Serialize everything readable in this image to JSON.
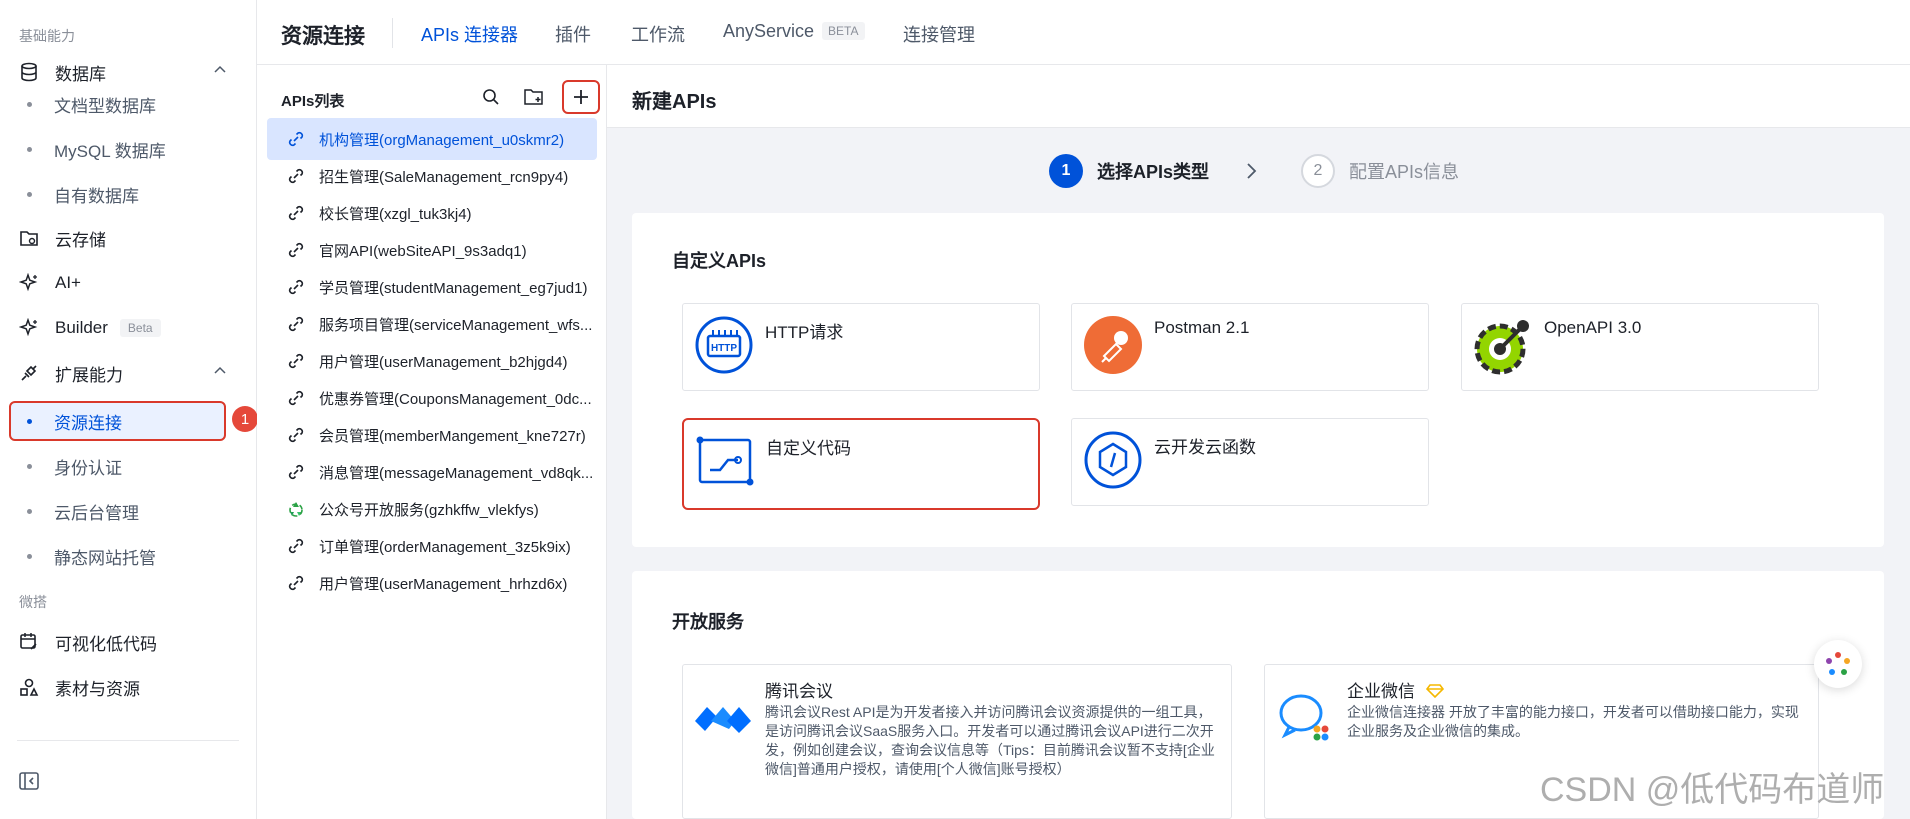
{
  "sidebar": {
    "section_basic": "基础能力",
    "database": "数据库",
    "db_items": [
      "文档型数据库",
      "MySQL 数据库",
      "自有数据库"
    ],
    "cloud_storage": "云存储",
    "ai": "AI+",
    "builder": "Builder",
    "builder_tag": "Beta",
    "extension": "扩展能力",
    "ext_items": [
      "资源连接",
      "身份认证",
      "云后台管理",
      "静态网站托管"
    ],
    "active_item": "资源连接",
    "step_badge": "1",
    "section_micro": "微搭",
    "lowcode": "可视化低代码",
    "assets": "素材与资源"
  },
  "topbar": {
    "title": "资源连接",
    "tabs": [
      "APIs 连接器",
      "插件",
      "工作流",
      "AnyService",
      "连接管理"
    ],
    "anyservice_tag": "BETA",
    "active_tab": "APIs 连接器"
  },
  "api_list": {
    "title": "APIs列表",
    "items": [
      "机构管理(orgManagement_u0skmr2)",
      "招生管理(SaleManagement_rcn9py4)",
      "校长管理(xzgl_tuk3kj4)",
      "官网API(webSiteAPI_9s3adq1)",
      "学员管理(studentManagement_eg7jud1)",
      "服务项目管理(serviceManagement_wfs...",
      "用户管理(userManagement_b2hjgd4)",
      "优惠券管理(CouponsManagement_0dc...",
      "会员管理(memberMangement_kne727r)",
      "消息管理(messageManagement_vd8qk...",
      "公众号开放服务(gzhkffw_vlekfys)",
      "订单管理(orderManagement_3z5k9ix)",
      "用户管理(userManagement_hrhzd6x)"
    ]
  },
  "main": {
    "title": "新建APIs",
    "step1_num": "1",
    "step1_label": "选择APIs类型",
    "step2_num": "2",
    "step2_label": "配置APIs信息",
    "custom_title": "自定义APIs",
    "custom_options": [
      "HTTP请求",
      "Postman 2.1",
      "OpenAPI 3.0",
      "自定义代码",
      "云开发云函数"
    ],
    "open_title": "开放服务",
    "services": [
      {
        "name": "腾讯会议",
        "desc": "腾讯会议Rest API是为开发者接入并访问腾讯会议资源提供的一组工具，是访问腾讯会议SaaS服务入口。开发者可以通过腾讯会议API进行二次开发，例如创建会议，查询会议信息等（Tips：目前腾讯会议暂不支持[企业微信]普通用户授权，请使用[个人微信]账号授权）"
      },
      {
        "name": "企业微信",
        "desc": "企业微信连接器 开放了丰富的能力接口，开发者可以借助接口能力，实现企业服务及企业微信的集成。"
      }
    ]
  },
  "watermark": "CSDN @低代码布道师",
  "colors": {
    "accent": "#0052d9",
    "highlight": "#d9392b",
    "background": "#f2f3f7"
  }
}
